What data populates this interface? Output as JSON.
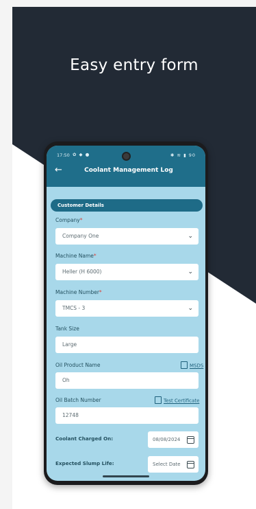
{
  "colors": {
    "dark_bg": "#222a35",
    "app_bar": "#1f6e8a",
    "screen_bg": "#a8d8ea",
    "required": "#d9433b"
  },
  "promo": {
    "headline": "Easy entry form"
  },
  "status_bar": {
    "time": "17:50",
    "left_icons": "✿ ◆ ●",
    "right_icons": "✱ ≋ ▮ 90"
  },
  "app_bar": {
    "back_icon": "arrow-left-icon",
    "title": "Coolant Management Log"
  },
  "section": {
    "title": "Customer Details"
  },
  "form": {
    "company": {
      "label": "Company",
      "required_mark": "*",
      "value": "Company One"
    },
    "machine_name": {
      "label": "Machine Name",
      "required_mark": "*",
      "value": "Heller (H 6000)"
    },
    "machine_number": {
      "label": "Machine Number",
      "required_mark": "*",
      "value": "TMCS - 3"
    },
    "tank_size": {
      "label": "Tank Size",
      "value": "Large"
    },
    "oil_product_name": {
      "label": "Oil Product Name",
      "value": "Oh",
      "link": "MSDS"
    },
    "oil_batch_number": {
      "label": "Oil Batch Number",
      "value": "12748",
      "link": "Test Certificate"
    },
    "coolant_charged_on": {
      "label": "Coolant Charged On:",
      "value": "08/08/2024"
    },
    "expected_sump_life": {
      "label": "Expected Slump Life:",
      "placeholder": "Select Date"
    }
  }
}
